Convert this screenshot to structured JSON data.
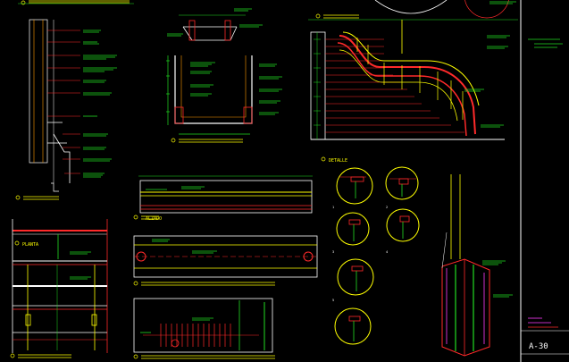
{
  "sheet": {
    "number": "A-30"
  },
  "views": {
    "planta": "PLANTA",
    "alzado": "ALZADO",
    "detalle": "DETALLE"
  },
  "details": [
    "1",
    "2",
    "3",
    "4",
    "5"
  ],
  "colors": {
    "background": "#000000",
    "white": "#ffffff",
    "red": "#ff2a2a",
    "yellow": "#ffff00",
    "green": "#22dd22",
    "cyan": "#00e5ff",
    "magenta": "#ff3cff",
    "orange": "#ff9900",
    "blue": "#4466ff"
  }
}
